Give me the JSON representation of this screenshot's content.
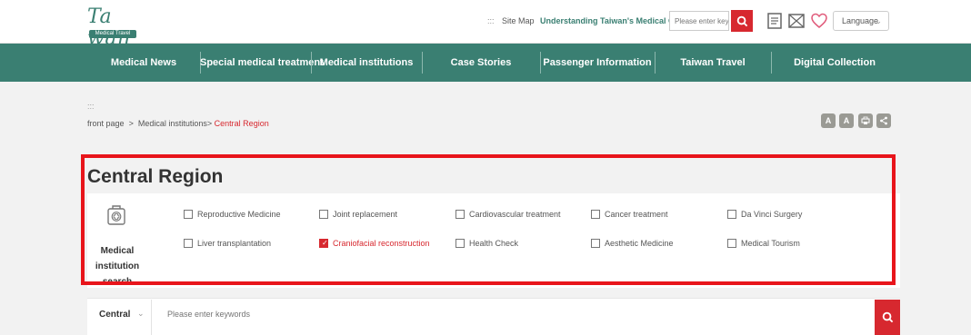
{
  "header": {
    "logo_text": "Ta wan",
    "logo_sub": "Medical Travel",
    "sitemap_dots": ":::",
    "sitemap": "Site Map",
    "understanding": "Understanding Taiwan's Medical Care",
    "search_placeholder": "Please enter key",
    "language": "Language",
    "icons": [
      "search-icon",
      "list-icon",
      "mail-icon",
      "heart-icon",
      "chevron-down-icon"
    ]
  },
  "nav": {
    "items": [
      {
        "label": "Medical News"
      },
      {
        "label": "Special medical treatment"
      },
      {
        "label": "Medical institutions"
      },
      {
        "label": "Case Stories"
      },
      {
        "label": "Passenger Information"
      },
      {
        "label": "Taiwan Travel"
      },
      {
        "label": "Digital Collection"
      }
    ]
  },
  "breadcrumb": {
    "dots": ":::",
    "home": "front page",
    "sep": ">",
    "parent": "Medical institutions>",
    "current": "Central Region"
  },
  "tools": {
    "font_small": "A",
    "font_large": "A",
    "print_icon": "print-icon",
    "share_icon": "share-icon"
  },
  "page": {
    "title": "Central Region"
  },
  "search_panel": {
    "label": "Medical institution search",
    "categories": [
      {
        "label": "Reproductive Medicine",
        "checked": false
      },
      {
        "label": "Joint replacement",
        "checked": false
      },
      {
        "label": "Cardiovascular treatment",
        "checked": false
      },
      {
        "label": "Cancer treatment",
        "checked": false
      },
      {
        "label": "Da Vinci Surgery",
        "checked": false
      },
      {
        "label": "Liver transplantation",
        "checked": false
      },
      {
        "label": "Craniofacial reconstruction",
        "checked": true
      },
      {
        "label": "Health Check",
        "checked": false
      },
      {
        "label": "Aesthetic Medicine",
        "checked": false
      },
      {
        "label": "Medical Tourism",
        "checked": false
      }
    ]
  },
  "keyword_search": {
    "region": "Central",
    "placeholder": "Please enter keywords"
  },
  "colors": {
    "brand": "#3a7f72",
    "accent_red": "#d7282f",
    "highlight": "#e8151b"
  }
}
